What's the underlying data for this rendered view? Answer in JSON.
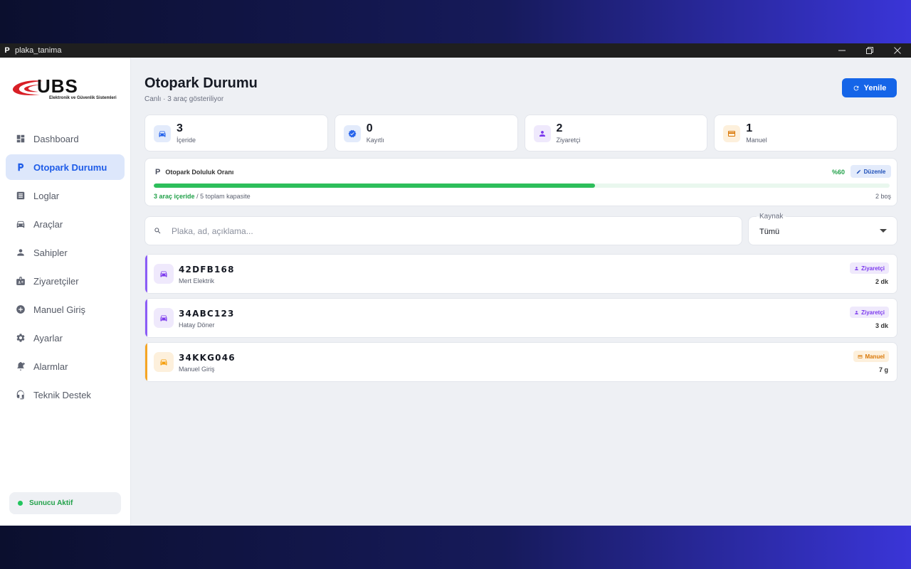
{
  "window": {
    "title": "plaka_tanima",
    "app_icon_letter": "P"
  },
  "sidebar": {
    "logo": {
      "text": "UBS",
      "subtitle": "Elektronik ve Güvenlik Sistemleri"
    },
    "items": [
      {
        "label": "Dashboard",
        "icon": "dashboard-icon"
      },
      {
        "label": "Otopark Durumu",
        "icon": "parking-icon"
      },
      {
        "label": "Loglar",
        "icon": "log-icon"
      },
      {
        "label": "Araçlar",
        "icon": "car-icon"
      },
      {
        "label": "Sahipler",
        "icon": "person-icon"
      },
      {
        "label": "Ziyaretçiler",
        "icon": "badge-icon"
      },
      {
        "label": "Manuel Giriş",
        "icon": "add-circle-icon"
      },
      {
        "label": "Ayarlar",
        "icon": "gear-icon"
      },
      {
        "label": "Alarmlar",
        "icon": "bell-icon"
      },
      {
        "label": "Teknik Destek",
        "icon": "headset-icon"
      }
    ],
    "active_index": 1,
    "server_status": "Sunucu Aktif"
  },
  "header": {
    "title": "Otopark Durumu",
    "subtitle": "Canlı · 3 araç gösteriliyor",
    "refresh_label": "Yenile"
  },
  "stats": [
    {
      "value": "3",
      "label": "İçeride",
      "icon": "car-icon",
      "color": "#2563eb",
      "bg": "#e3ebfb"
    },
    {
      "value": "0",
      "label": "Kayıtlı",
      "icon": "verified-icon",
      "color": "#2563eb",
      "bg": "#e3ebfb"
    },
    {
      "value": "2",
      "label": "Ziyaretçi",
      "icon": "person-icon",
      "color": "#7c3aed",
      "bg": "#efe9fc"
    },
    {
      "value": "1",
      "label": "Manuel",
      "icon": "card-icon",
      "color": "#d97706",
      "bg": "#fdf0dc"
    }
  ],
  "occupancy": {
    "title": "Otopark Doluluk Oranı",
    "percent_label": "%60",
    "fraction": 0.6,
    "edit_label": "Düzenle",
    "inside_text": "3 araç içeride",
    "capacity_text": "/ 5 toplam kapasite",
    "free_text": "2 boş"
  },
  "search": {
    "placeholder": "Plaka, ad, açıklama...",
    "value": ""
  },
  "source_filter": {
    "label": "Kaynak",
    "value": "Tümü"
  },
  "vehicles": [
    {
      "plate": "42DFB168",
      "owner": "Mert Elektrik",
      "badge": "Ziyaretçi",
      "badge_type": "visitor",
      "time": "2 dk",
      "accent": "#8b5cf6"
    },
    {
      "plate": "34ABC123",
      "owner": "Hatay Döner",
      "badge": "Ziyaretçi",
      "badge_type": "visitor",
      "time": "3 dk",
      "accent": "#8b5cf6"
    },
    {
      "plate": "34KKG046",
      "owner": "Manuel Giriş",
      "badge": "Manuel",
      "badge_type": "manual",
      "time": "7 g",
      "accent": "#f5a524"
    }
  ]
}
